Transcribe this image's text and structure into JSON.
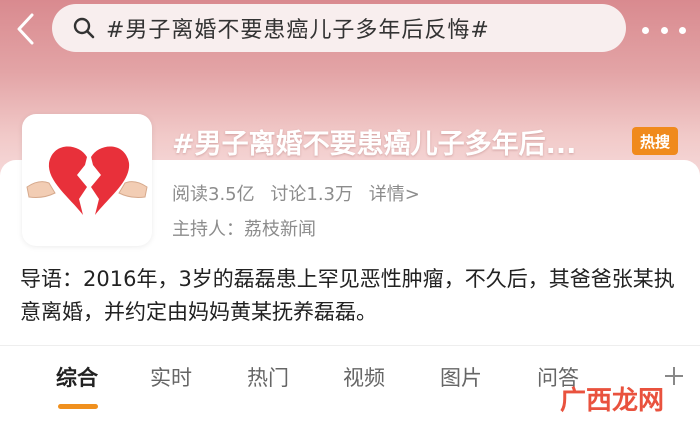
{
  "search": {
    "query": "#男子离婚不要患癌儿子多年后反悔#"
  },
  "topic": {
    "title": "#男子离婚不要患癌儿子多年后...",
    "badge": "热搜",
    "reads": "阅读3.5亿",
    "discussions": "讨论1.3万",
    "details": "详情>",
    "host": "主持人：荔枝新闻",
    "intro": "导语：2016年，3岁的磊磊患上罕见恶性肿瘤，不久后，其爸爸张某执意离婚，并约定由妈妈黄某抚养磊磊。"
  },
  "tabs": [
    {
      "label": "综合",
      "active": true
    },
    {
      "label": "实时",
      "active": false
    },
    {
      "label": "热门",
      "active": false
    },
    {
      "label": "视频",
      "active": false
    },
    {
      "label": "图片",
      "active": false
    },
    {
      "label": "问答",
      "active": false
    }
  ],
  "watermark": "广西龙网",
  "colors": {
    "accent": "#f0901e",
    "hot_badge": "#f08a1c",
    "heart": "#e8303a",
    "header_gradient_top": "#d98a8f"
  },
  "icons": {
    "back": "chevron-left-icon",
    "search": "search-icon",
    "more": "more-icon",
    "add_tab": "plus-icon",
    "thumbnail": "broken-heart-icon"
  }
}
